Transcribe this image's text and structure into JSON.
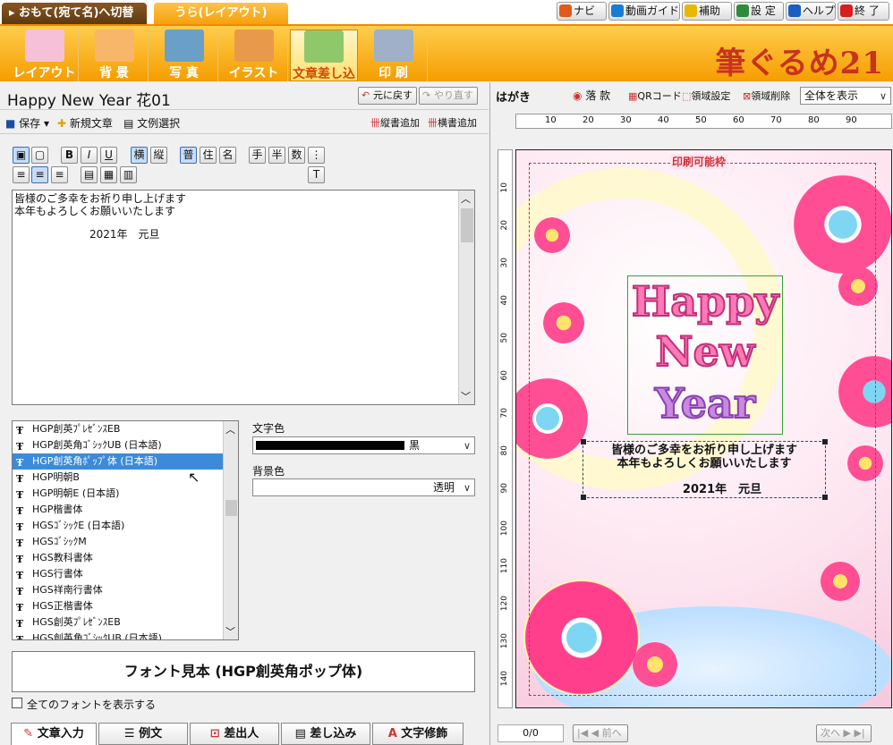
{
  "tabs": {
    "front": "▸ おもて(宛て名)へ切替",
    "back": "うら(レイアウト)"
  },
  "toolbar": [
    {
      "label": "ナビ",
      "icon": "pointer-icon",
      "color": "#e05a1c"
    },
    {
      "label": "動画ガイド",
      "icon": "play-icon",
      "color": "#1a7bd4"
    },
    {
      "label": "補助",
      "icon": "star-icon",
      "color": "#e8b800"
    },
    {
      "label": "設 定",
      "icon": "wrench-icon",
      "color": "#2e8b3c"
    },
    {
      "label": "ヘルプ",
      "icon": "help-icon",
      "color": "#1a5fbf"
    },
    {
      "label": "終 了",
      "icon": "close-icon",
      "color": "#d81e1e"
    }
  ],
  "ribbon": [
    {
      "label": "レイアウト",
      "icon": "layout-icon"
    },
    {
      "label": "背 景",
      "icon": "background-icon"
    },
    {
      "label": "写 真",
      "icon": "photo-icon"
    },
    {
      "label": "イラスト",
      "icon": "illustration-icon"
    },
    {
      "label": "文章差し込み",
      "icon": "text-insert-icon",
      "selected": true
    },
    {
      "label": "印 刷",
      "icon": "printer-icon"
    }
  ],
  "brand": "筆ぐるめ21",
  "doc": {
    "title": "Happy New Year  花01",
    "undo": "元に戻す",
    "redo": "やり直す"
  },
  "filebar": {
    "save": "保存",
    "new": "新規文章",
    "select": "文例選択",
    "vadd": "縦書追加",
    "hadd": "横書追加"
  },
  "format": [
    "横",
    "縦",
    "普",
    "住",
    "名",
    "手",
    "半",
    "数"
  ],
  "text": {
    "line1": "皆様のご多幸をお祈り申し上げます",
    "line2": "本年もよろしくお願いいたします",
    "line3": "2021年　元旦"
  },
  "fonts": [
    "HGP創英ﾌﾟﾚｾﾞﾝｽEB",
    "HGP創英角ｺﾞｼｯｸUB (日本語)",
    "HGP創英角ﾎﾟｯﾌﾟ体 (日本語)",
    "HGP明朝B",
    "HGP明朝E (日本語)",
    "HGP楷書体",
    "HGSｺﾞｼｯｸE (日本語)",
    "HGSｺﾞｼｯｸM",
    "HGS教科書体",
    "HGS行書体",
    "HGS祥南行書体",
    "HGS正楷書体",
    "HGS創英ﾌﾟﾚｾﾞﾝｽEB",
    "HGS創英角ｺﾞｼｯｸUB (日本語)"
  ],
  "selected_font_index": 2,
  "color": {
    "text_label": "文字色",
    "text_value": "黒",
    "bg_label": "背景色",
    "bg_value": "透明"
  },
  "preview": "フォント見本 (HGP創英角ポップ体)",
  "showall": "全てのフォントを表示する",
  "bottom_tabs": [
    "文章入力",
    "例文",
    "差出人",
    "差し込み",
    "文字修飾"
  ],
  "right": {
    "title": "はがき",
    "stamp": "落 款",
    "qr": "QRコード",
    "area": "領域設定",
    "delete": "領域削除",
    "zoom": "全体を表示",
    "print_area": "印刷可能枠",
    "page": "0/0",
    "prev": "前へ",
    "next": "次へ"
  },
  "ruler_h": [
    "10",
    "20",
    "30",
    "40",
    "50",
    "60",
    "70",
    "80",
    "90"
  ],
  "ruler_v": [
    "10",
    "20",
    "30",
    "40",
    "50",
    "60",
    "70",
    "80",
    "90",
    "100",
    "110",
    "120",
    "130",
    "140"
  ],
  "card": {
    "w1": "Happy",
    "w2": "New",
    "w3": "Year"
  }
}
